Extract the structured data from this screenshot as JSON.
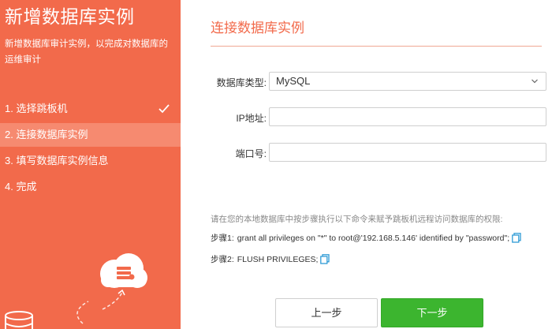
{
  "sidebar": {
    "title": "新增数据库实例",
    "description": "新增数据库审计实例，以完成对数据库的运维审计",
    "steps": [
      {
        "label": "1. 选择跳板机",
        "done": true
      },
      {
        "label": "2. 连接数据库实例",
        "active": true
      },
      {
        "label": "3. 填写数据库实例信息"
      },
      {
        "label": "4. 完成"
      }
    ]
  },
  "main": {
    "title": "连接数据库实例",
    "form": {
      "db_type_label": "数据库类型:",
      "db_type_value": "MySQL",
      "ip_label": "IP地址:",
      "ip_value": "",
      "port_label": "端口号:",
      "port_value": ""
    },
    "hint": "请在您的本地数据库中按步骤执行以下命令来赋予跳板机远程访问数据库的权限:",
    "commands": [
      {
        "prefix": "步骤1:",
        "text": "grant all privileges on \"*\" to root@'192.168.5.146' identified by \"password\";"
      },
      {
        "prefix": "步骤2:",
        "text": "FLUSH PRIVILEGES;"
      }
    ],
    "buttons": {
      "prev": "上一步",
      "next": "下一步"
    }
  },
  "colors": {
    "accent": "#f26a4b",
    "active_step": "#f68a70",
    "primary_button": "#3cb52f",
    "copy_icon": "#2f9bd6"
  }
}
